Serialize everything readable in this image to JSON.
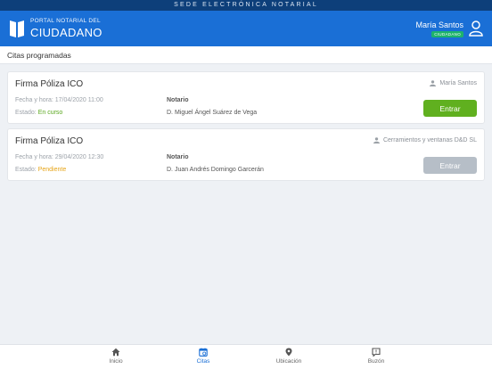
{
  "topbar": {
    "text": "SEDE ELECTRÓNICA NOTARIAL"
  },
  "header": {
    "brand_small": "PORTAL NOTARIAL DEL",
    "brand_big": "CIUDADANO",
    "user_name": "María Santos",
    "user_badge": "CIUDADANO"
  },
  "section": {
    "title": "Citas programadas"
  },
  "appointments": [
    {
      "title": "Firma Póliza ICO",
      "client": "María Santos",
      "datetime_label": "Fecha y hora:",
      "datetime": "17/04/2020 11:00",
      "status_label": "Estado:",
      "status": "En curso",
      "notario_label": "Notario",
      "notario": "D. Miguel Ángel Suárez de Vega",
      "button": "Entrar",
      "button_enabled": true
    },
    {
      "title": "Firma Póliza ICO",
      "client": "Cerramientos y ventanas D&D SL",
      "datetime_label": "Fecha y hora:",
      "datetime": "29/04/2020 12:30",
      "status_label": "Estado:",
      "status": "Pendiente",
      "notario_label": "Notario",
      "notario": "D. Juan Andrés Domingo Garcerán",
      "button": "Entrar",
      "button_enabled": false
    }
  ],
  "nav": [
    {
      "label": "Inicio",
      "icon": "home-icon",
      "active": false
    },
    {
      "label": "Citas",
      "icon": "calendar-icon",
      "active": true
    },
    {
      "label": "Ubicación",
      "icon": "location-pin-icon",
      "active": false
    },
    {
      "label": "Buzón",
      "icon": "mailbox-icon",
      "active": false
    }
  ],
  "colors": {
    "header": "#1a6fd6",
    "topbar": "#0d3f7a",
    "active_button": "#60b01f",
    "disabled_button": "#b6bec7",
    "status_in_progress": "#5aa71e",
    "status_pending": "#e6a417",
    "badge": "#1db36b"
  }
}
